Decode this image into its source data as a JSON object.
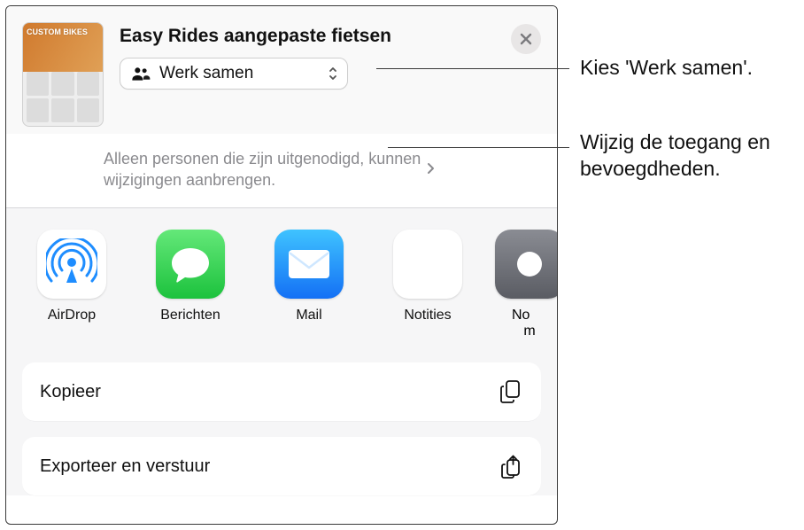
{
  "header": {
    "title": "Easy Rides aangepaste fietsen",
    "thumb_band_text": "CUSTOM\nBIKES",
    "mode_label": "Werk samen",
    "permission_text": "Alleen personen die zijn uitgenodigd, kunnen wijzigingen aanbrengen."
  },
  "apps": {
    "airdrop": "AirDrop",
    "berichten": "Berichten",
    "mail": "Mail",
    "notities": "Notities",
    "more_prefix": "No",
    "more_suffix": "m"
  },
  "actions": {
    "copy": "Kopieer",
    "export": "Exporteer en verstuur"
  },
  "callouts": {
    "c1": "Kies 'Werk samen'.",
    "c2": "Wijzig de toegang en bevoegdheden."
  }
}
